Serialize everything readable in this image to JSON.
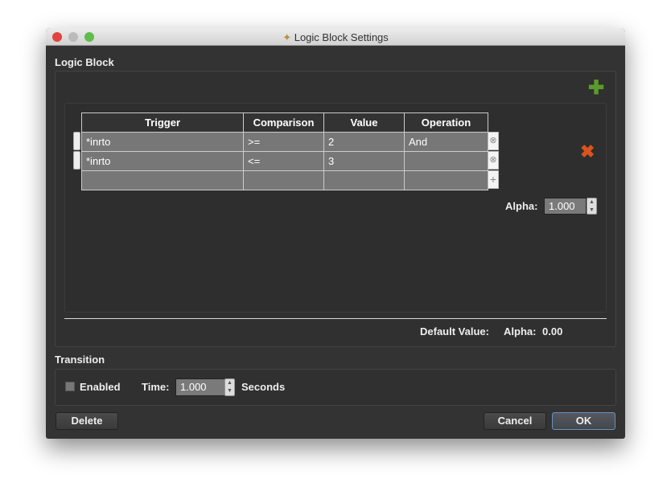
{
  "window": {
    "title": "Logic Block Settings"
  },
  "logic_block": {
    "label": "Logic Block",
    "table": {
      "headers": [
        "Trigger",
        "Comparison",
        "Value",
        "Operation"
      ],
      "rows": [
        [
          "*inrto",
          ">=",
          "2",
          "And"
        ],
        [
          "*inrto",
          "<=",
          "3",
          ""
        ],
        [
          "",
          "",
          "",
          ""
        ]
      ]
    },
    "alpha_label": "Alpha:",
    "alpha_value": "1.000",
    "default_value_label": "Default Value:",
    "default_alpha_label": "Alpha:",
    "default_alpha_value": "0.00"
  },
  "transition": {
    "label": "Transition",
    "enabled_label": "Enabled",
    "enabled": false,
    "time_label": "Time:",
    "time_value": "1.000",
    "seconds_label": "Seconds"
  },
  "buttons": {
    "delete": "Delete",
    "cancel": "Cancel",
    "ok": "OK"
  },
  "colors": {
    "add": "#5a9a2a",
    "remove": "#d9541e",
    "ok_border": "#6a8fc0"
  }
}
